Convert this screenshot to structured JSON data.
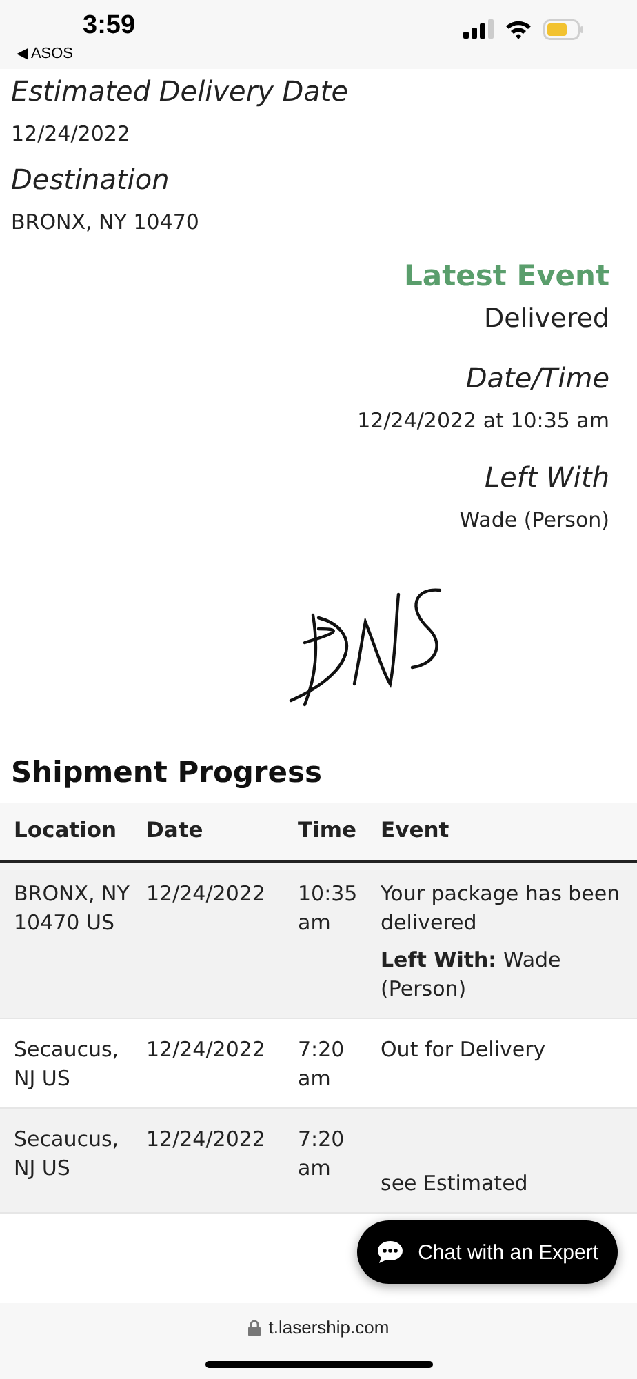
{
  "status_bar": {
    "time": "3:59",
    "back_label": "◀ ASOS"
  },
  "fields": [
    {
      "label": "Estimated Delivery Date",
      "value": "12/24/2022"
    },
    {
      "label": "Destination",
      "value": "BRONX, NY 10470"
    }
  ],
  "latest_event": {
    "heading": "Latest Event",
    "status": "Delivered",
    "fields": [
      {
        "label": "Date/Time",
        "value": "12/24/2022 at 10:35 am"
      },
      {
        "label": "Left With",
        "value": "Wade (Person)"
      }
    ]
  },
  "shipment_progress": {
    "title": "Shipment Progress",
    "columns": [
      "Location",
      "Date",
      "Time",
      "Event"
    ],
    "rows": [
      {
        "location": "BRONX, NY 10470 US",
        "date": "12/24/2022",
        "time": "10:35 am",
        "event": "Your package has been delivered",
        "note": "**Left With:** Wade (Person)"
      },
      {
        "location": "Secaucus, NJ US",
        "date": "12/24/2022",
        "time": "7:20 am",
        "event": "Out for Delivery"
      },
      {
        "location": "Secaucus, NJ US",
        "date": "12/24/2022",
        "time": "7:20 am",
        "event": "see Estimated"
      }
    ]
  },
  "chat_button": {
    "label": "Chat with an Expert"
  },
  "address_bar": {
    "url": "t.lasership.com"
  }
}
